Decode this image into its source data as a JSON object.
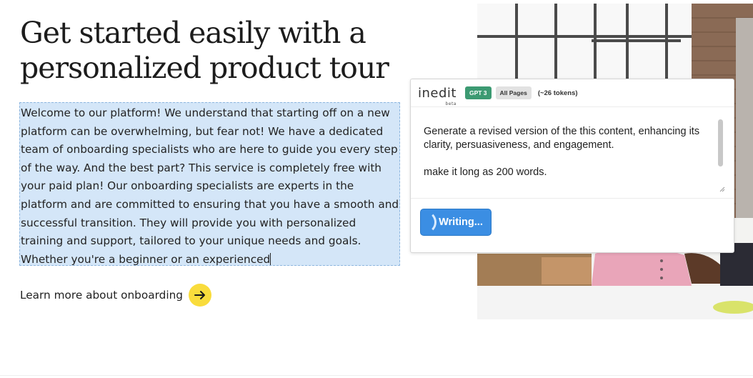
{
  "main": {
    "headline": "Get started easily with a personalized product tour",
    "body_text": "Welcome to our platform! We understand that starting off on a new platform can be overwhelming, but fear not! We have a dedicated team of onboarding specialists who are here to guide you every step of the way. And the best part? This service is completely free with your paid plan! Our onboarding specialists are experts in the platform and are committed to ensuring that you have a smooth and successful transition. They will provide you with personalized training and support, tailored to your unique needs and goals. Whether you're a beginner or an experienced",
    "learn_more_label": "Learn more about onboarding",
    "learn_more_icon": "arrow-right-icon",
    "accent_color": "#f9dc3c"
  },
  "popup": {
    "logo_text": "inedit",
    "logo_sub": "beta",
    "model_badge": "GPT 3",
    "scope_badge": "All Pages",
    "token_count": "(~26 tokens)",
    "prompt_text": "Generate a revised version of the this content, enhancing its clarity, persuasiveness, and engagement.\n\nmake it long as 200 words.",
    "action_button": "Writing...",
    "model_badge_color": "#3c9a72",
    "button_color": "#3b8ee3"
  }
}
